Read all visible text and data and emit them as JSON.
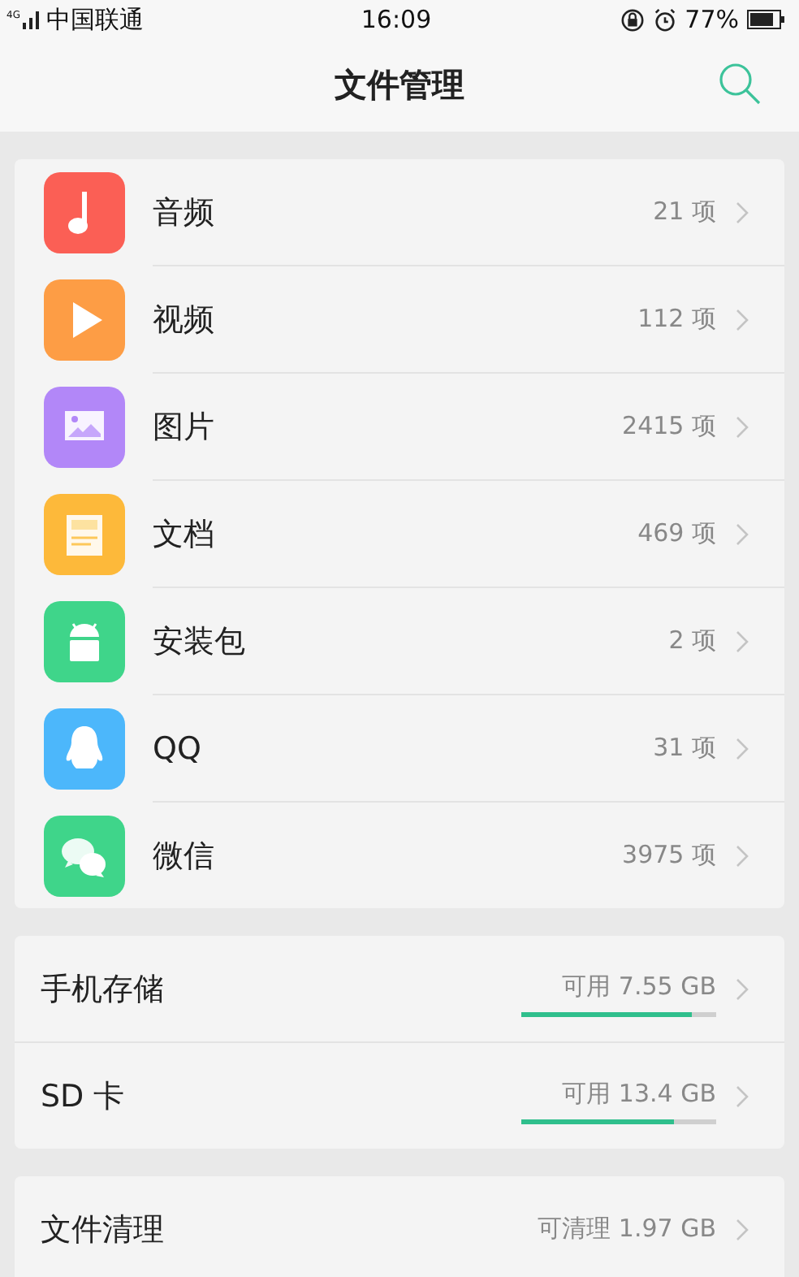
{
  "status_bar": {
    "network": "4G",
    "carrier": "中国联通",
    "time": "16:09",
    "battery": "77%"
  },
  "header": {
    "title": "文件管理"
  },
  "categories": [
    {
      "kind": "music",
      "label": "音频",
      "count": "21 项",
      "color": "#fb5f55"
    },
    {
      "kind": "video",
      "label": "视频",
      "count": "112 项",
      "color": "#fd9d45"
    },
    {
      "kind": "image",
      "label": "图片",
      "count": "2415 项",
      "color": "#b287f8"
    },
    {
      "kind": "document",
      "label": "文档",
      "count": "469 项",
      "color": "#fdb93a"
    },
    {
      "kind": "package",
      "label": "安装包",
      "count": "2 项",
      "color": "#3fd58a"
    },
    {
      "kind": "qq",
      "label": "QQ",
      "count": "31 项",
      "color": "#4cb7fb"
    },
    {
      "kind": "wechat",
      "label": "微信",
      "count": "3975 项",
      "color": "#3fd58a"
    }
  ],
  "storage": [
    {
      "label": "手机存储",
      "free": "可用 7.55 GB",
      "level": 0.875
    },
    {
      "label": "SD 卡",
      "free": "可用 13.4 GB",
      "level": 0.78
    }
  ],
  "cleanup": {
    "label": "文件清理",
    "value": "可清理 1.97 GB"
  }
}
